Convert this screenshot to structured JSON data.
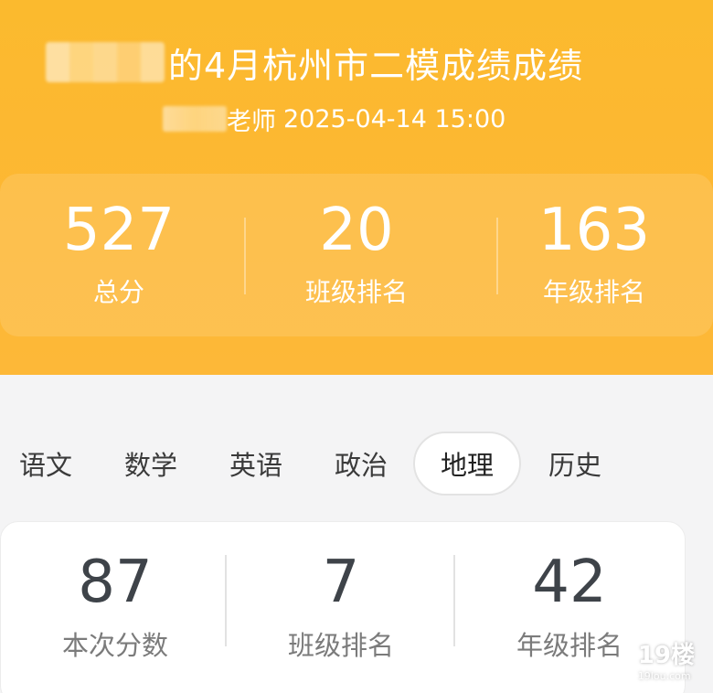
{
  "header": {
    "title": "的4月杭州市二模成绩成绩",
    "teacher_suffix": "老师",
    "datetime": "2025-04-14 15:00"
  },
  "summary": {
    "items": [
      {
        "value": "527",
        "label": "总分"
      },
      {
        "value": "20",
        "label": "班级排名"
      },
      {
        "value": "163",
        "label": "年级排名"
      }
    ]
  },
  "tabs": {
    "items": [
      {
        "label": "语文"
      },
      {
        "label": "数学"
      },
      {
        "label": "英语"
      },
      {
        "label": "政治"
      },
      {
        "label": "地理"
      },
      {
        "label": "历史"
      }
    ],
    "active": "地理"
  },
  "subject": {
    "items": [
      {
        "value": "87",
        "label": "本次分数"
      },
      {
        "value": "7",
        "label": "班级排名"
      },
      {
        "value": "42",
        "label": "年级排名"
      }
    ]
  },
  "watermark": {
    "text": "19楼",
    "sub": "19lou.com"
  },
  "colors": {
    "header_bg": "#fdb733",
    "text_dark": "#3e4349",
    "text_muted": "#7b7b7b"
  }
}
